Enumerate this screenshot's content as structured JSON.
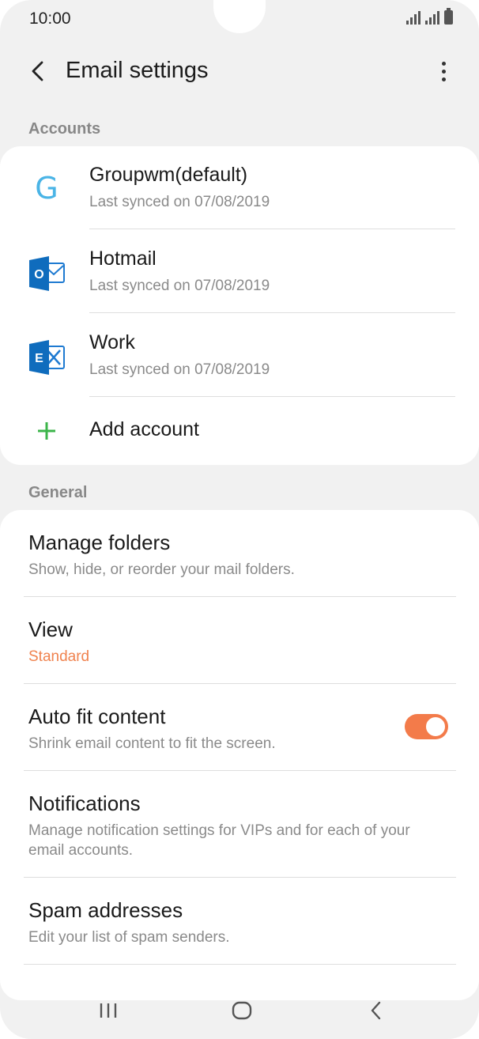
{
  "status": {
    "time": "10:00"
  },
  "header": {
    "title": "Email settings"
  },
  "sections": {
    "accounts_label": "Accounts",
    "general_label": "General"
  },
  "accounts": [
    {
      "name": "Groupwm(default)",
      "synced": "Last synced on 07/08/2019",
      "icon": "google-g-icon",
      "icon_glyph": "G"
    },
    {
      "name": "Hotmail",
      "synced": "Last synced on 07/08/2019",
      "icon": "outlook-icon",
      "icon_glyph": "O"
    },
    {
      "name": "Work",
      "synced": "Last synced on 07/08/2019",
      "icon": "exchange-icon",
      "icon_glyph": "E"
    }
  ],
  "add_account": {
    "label": "Add account",
    "icon": "plus-icon"
  },
  "settings": {
    "manage_folders": {
      "title": "Manage folders",
      "sub": "Show, hide, or reorder your mail folders."
    },
    "view": {
      "title": "View",
      "value": "Standard"
    },
    "auto_fit": {
      "title": "Auto fit content",
      "sub": "Shrink email content to fit the screen.",
      "enabled": true
    },
    "notifications": {
      "title": "Notifications",
      "sub": "Manage notification settings for VIPs and for each of your email accounts."
    },
    "spam": {
      "title": "Spam addresses",
      "sub": "Edit your list of spam senders."
    }
  },
  "colors": {
    "accent": "#f37b4a",
    "google_blue": "#4ab4e6",
    "outlook_blue": "#0f6cbd",
    "add_green": "#3cb54a"
  }
}
